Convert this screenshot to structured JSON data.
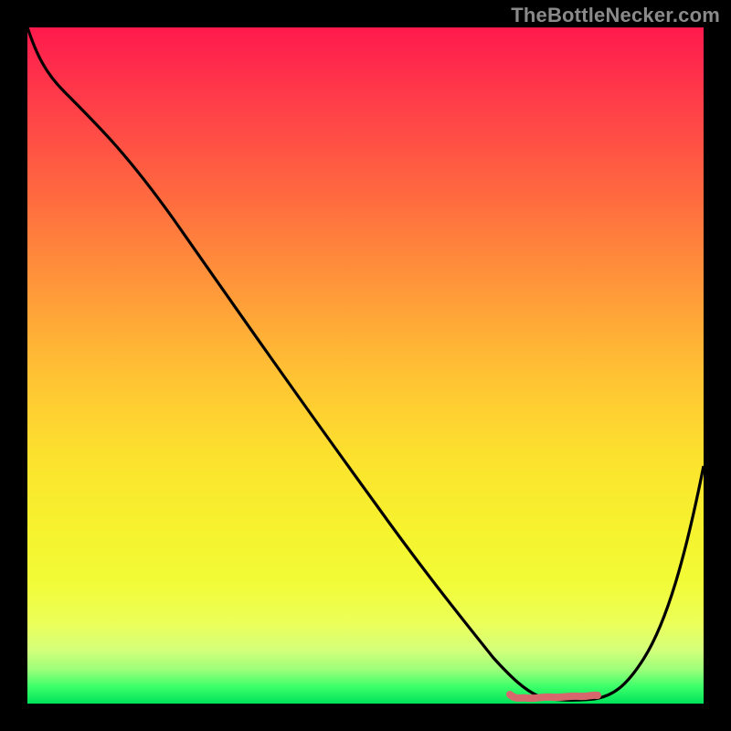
{
  "watermark": "TheBottleNecker.com",
  "colors": {
    "frame": "#000000",
    "curve": "#000000",
    "marker": "#d6686d",
    "gradient_top": "#ff1a4d",
    "gradient_bottom": "#00e35a"
  },
  "chart_data": {
    "type": "line",
    "title": "",
    "xlabel": "",
    "ylabel": "",
    "xlim": [
      0,
      100
    ],
    "ylim": [
      0,
      100
    ],
    "grid": false,
    "legend": false,
    "background": "rainbow-gradient (red top to green bottom)",
    "series": [
      {
        "name": "bottleneck-curve",
        "x": [
          0,
          3,
          8,
          15,
          25,
          35,
          45,
          55,
          62,
          66,
          70,
          75,
          80,
          85,
          92,
          100
        ],
        "y": [
          100,
          97,
          94,
          89,
          78,
          65,
          52,
          39,
          27,
          18,
          10,
          3,
          1,
          1,
          10,
          36
        ]
      }
    ],
    "annotations": [
      {
        "name": "trough-marker",
        "type": "segment",
        "x": [
          71,
          84
        ],
        "y": [
          1,
          1
        ],
        "style": "pink-dashed"
      }
    ]
  }
}
